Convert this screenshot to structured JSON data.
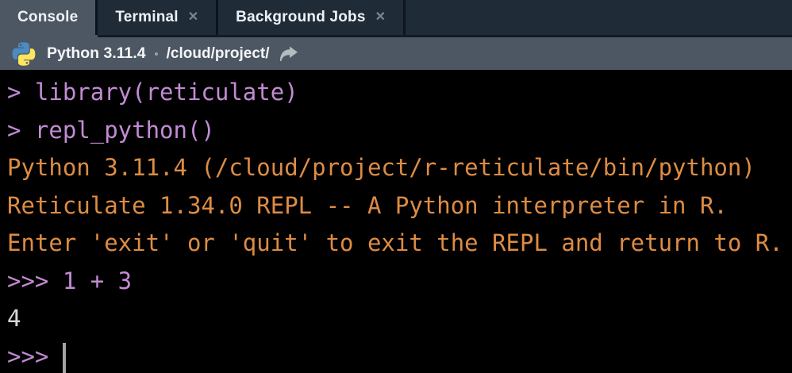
{
  "tabs": [
    {
      "label": "Console",
      "active": true,
      "closable": false
    },
    {
      "label": "Terminal",
      "active": false,
      "closable": true
    },
    {
      "label": "Background Jobs",
      "active": false,
      "closable": true
    }
  ],
  "icons": {
    "close": "✕",
    "python_logo": "python-logo",
    "forward_arrow": "curved-forward-arrow"
  },
  "header": {
    "interpreter": "Python 3.11.4",
    "separator": "·",
    "path": "/cloud/project/"
  },
  "console": {
    "lines": [
      {
        "text": "> library(reticulate)",
        "role": "r-input"
      },
      {
        "text": "> repl_python()",
        "role": "r-input"
      },
      {
        "text": "Python 3.11.4 (/cloud/project/r-reticulate/bin/python)",
        "role": "python-banner"
      },
      {
        "text": "Reticulate 1.34.0 REPL -- A Python interpreter in R.",
        "role": "python-banner"
      },
      {
        "text": "Enter 'exit' or 'quit' to exit the REPL and return to R.",
        "role": "python-banner"
      },
      {
        "text": ">>> 1 + 3",
        "role": "python-input"
      },
      {
        "text": "4",
        "role": "python-output"
      },
      {
        "text": ">>> ",
        "role": "python-prompt",
        "cursor": true
      }
    ]
  },
  "colors": {
    "tabbar_bg": "#202b38",
    "tab_separator": "#0d141d",
    "tab_bottom_border": "#121a25",
    "active_tab_bg": "#4d5763",
    "header_bg": "#4d5763",
    "tab_text": "#eef1f4",
    "close_icon": "#7a8795",
    "console_bg": "#000000",
    "input_purple": "#c28bd3",
    "output_orange": "#dd8c43",
    "result_white": "#d6d6d6",
    "cursor": "#a3a3a3",
    "dot_separator": "#98a0a8",
    "arrow_gray": "#b3bac0",
    "python_blue": "#4b8bbe",
    "python_yellow": "#ffe45e"
  }
}
